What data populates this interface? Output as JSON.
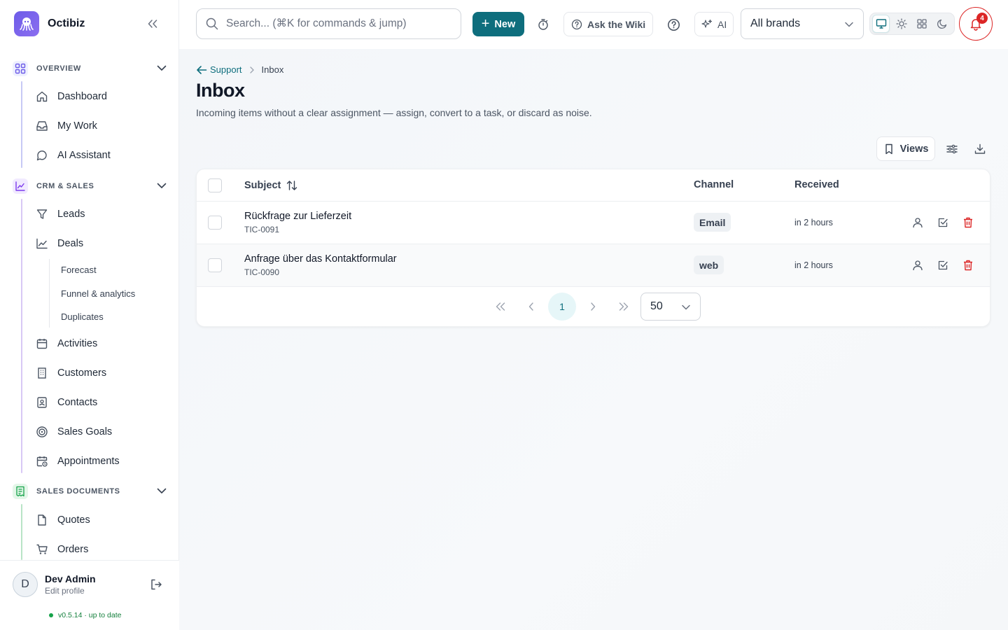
{
  "app": {
    "name": "Octibiz"
  },
  "sidebar": {
    "sections": [
      {
        "label": "OVERVIEW",
        "items": [
          "Dashboard",
          "My Work",
          "AI Assistant"
        ]
      },
      {
        "label": "CRM & SALES",
        "items": [
          "Leads",
          "Deals",
          "Activities",
          "Customers",
          "Contacts",
          "Sales Goals",
          "Appointments"
        ],
        "deals_sub": [
          "Forecast",
          "Funnel & analytics",
          "Duplicates"
        ]
      },
      {
        "label": "SALES DOCUMENTS",
        "items": [
          "Quotes",
          "Orders"
        ]
      }
    ],
    "user": {
      "initial": "D",
      "name": "Dev Admin",
      "sub": "Edit profile"
    },
    "version": "v0.5.14 · up to date"
  },
  "topbar": {
    "search_placeholder": "Search... (⌘K for commands & jump)",
    "new_label": "New",
    "wiki_label": "Ask the Wiki",
    "ai_label": "AI",
    "brand_filter": "All brands",
    "notification_count": "4"
  },
  "main": {
    "breadcrumb": {
      "parent": "Support",
      "current": "Inbox"
    },
    "title": "Inbox",
    "description": "Incoming items without a clear assignment — assign, convert to a task, or discard as noise.",
    "views_label": "Views",
    "table": {
      "columns": [
        "Subject",
        "Channel",
        "Received"
      ],
      "rows": [
        {
          "subject": "Rückfrage zur Lieferzeit",
          "id": "TIC-0091",
          "channel": "Email",
          "received": "in 2 hours"
        },
        {
          "subject": "Anfrage über das Kontaktformular",
          "id": "TIC-0090",
          "channel": "web",
          "received": "in 2 hours"
        }
      ]
    },
    "pagination": {
      "current_page": "1",
      "page_size": "50"
    }
  },
  "colors": {
    "accent": "#0e6e7d",
    "danger": "#dc2626",
    "brand": "#6d5ce8"
  }
}
